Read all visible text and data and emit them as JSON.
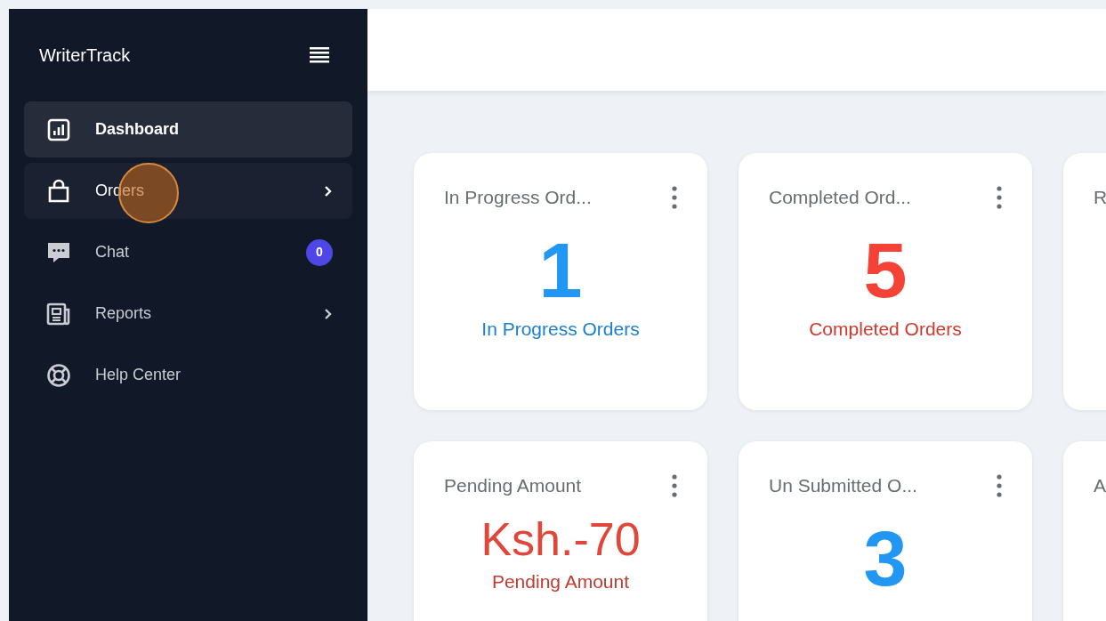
{
  "sidebar": {
    "brand": "WriterTrack",
    "items": [
      {
        "label": "Dashboard",
        "selected": true,
        "highlighted": false,
        "has_submenu": false
      },
      {
        "label": "Orders",
        "selected": false,
        "highlighted": true,
        "has_submenu": true
      },
      {
        "label": "Chat",
        "selected": false,
        "highlighted": false,
        "has_submenu": false,
        "badge": "0"
      },
      {
        "label": "Reports",
        "selected": false,
        "highlighted": false,
        "has_submenu": true
      },
      {
        "label": "Help Center",
        "selected": false,
        "highlighted": false,
        "has_submenu": false
      }
    ]
  },
  "cards": [
    {
      "title": "In Progress Ord...",
      "kind": "count",
      "value": "1",
      "label": "In Progress Orders",
      "color": "#2196f3"
    },
    {
      "title": "Completed Ord...",
      "kind": "count",
      "value": "5",
      "label": "Completed Orders",
      "color": "#f44336"
    },
    {
      "title": "R",
      "kind": "cut"
    },
    {
      "title": "Pending Amount",
      "kind": "amount",
      "value": "Ksh.-70",
      "label": "Pending Amount",
      "color": "#e0463a"
    },
    {
      "title": "Un Submitted O...",
      "kind": "count",
      "value": "3",
      "color": "#2196f3"
    },
    {
      "title": "A",
      "kind": "cut"
    }
  ]
}
